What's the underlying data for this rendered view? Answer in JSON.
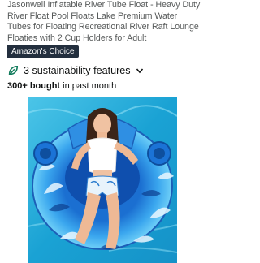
{
  "product": {
    "title": "Jasonwell Inflatable River Tube Float - Heavy Duty River Float Pool Floats Lake Premium Water Tubes for Floating Recreational River Raft Lounge Floaties with 2 Cup Holders for Adult",
    "badge": "Amazon's Choice",
    "sustainability": {
      "text": "3 sustainability features",
      "icon": "leaf-icon",
      "expand_icon": "chevron-down-icon"
    },
    "purchase_stats": {
      "count": "300+ bought",
      "suffix": " in past month"
    }
  },
  "colors": {
    "badge_bg": "#232f3e",
    "badge_text": "#ffffff",
    "leaf": "#0f7a5a",
    "water": "#1aa9d6",
    "float_main": "#2a8fe0"
  }
}
